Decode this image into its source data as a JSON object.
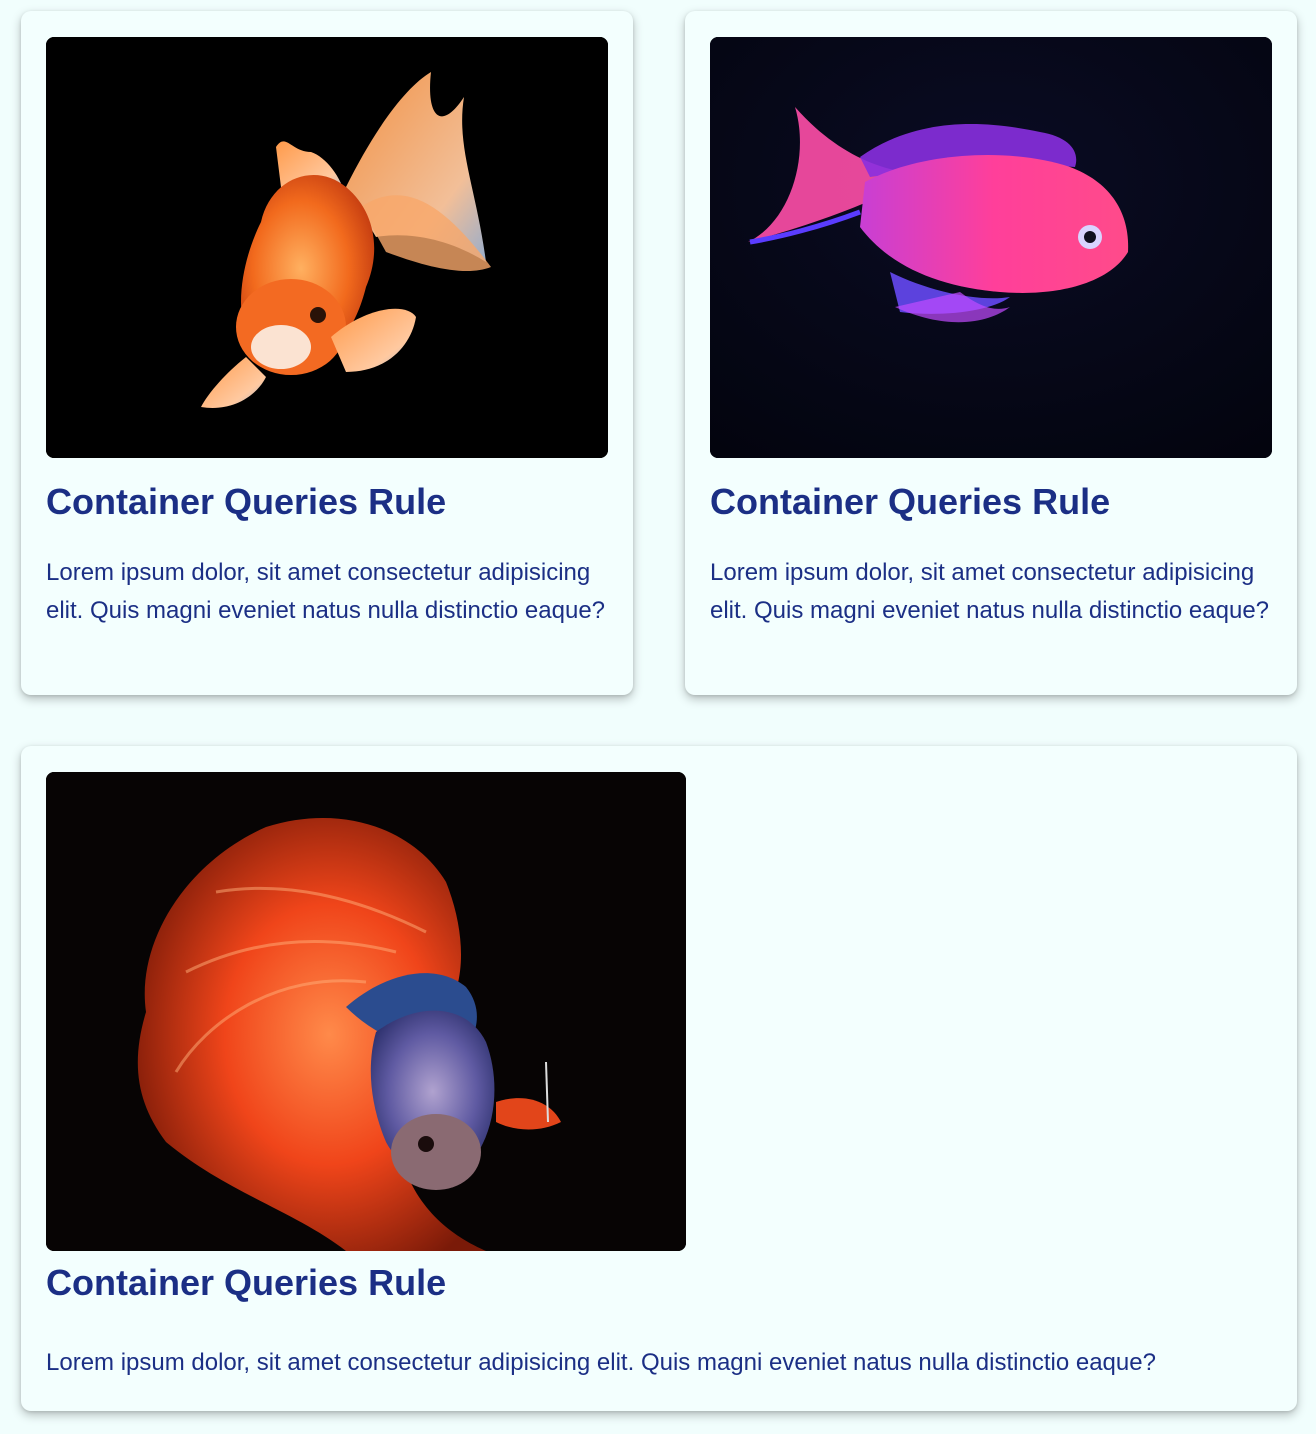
{
  "cards": [
    {
      "image": "goldfish",
      "title": "Container Queries Rule",
      "description": "Lorem ipsum dolor, sit amet consectetur adipisicing elit. Quis magni eveniet natus nulla distinctio eaque?"
    },
    {
      "image": "pink-anthias-fish",
      "title": "Container Queries Rule",
      "description": "Lorem ipsum dolor, sit amet consectetur adipisicing elit. Quis magni eveniet natus nulla distinctio eaque?"
    },
    {
      "image": "betta-fish",
      "title": "Container Queries Rule",
      "description": "Lorem ipsum dolor, sit amet consectetur adipisicing elit. Quis magni eveniet natus nulla distinctio eaque?"
    }
  ],
  "colors": {
    "page_background": "#f1fefd",
    "card_background": "#f3fffe",
    "text": "#1b2f85"
  }
}
